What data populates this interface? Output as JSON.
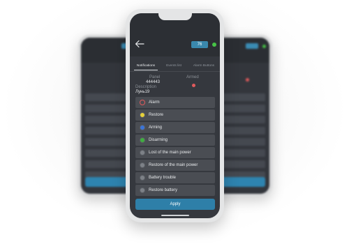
{
  "header": {
    "panel_number": "76"
  },
  "tabs": [
    {
      "label": "Notifications",
      "active": true
    },
    {
      "label": "Events list",
      "active": false
    },
    {
      "label": "Alarm Buttons",
      "active": false
    }
  ],
  "panel_info": {
    "panel_label": "Panel",
    "panel_value": "444443",
    "armed_label": "Armed",
    "description_label": "Description",
    "description_value": "Лунь19"
  },
  "notifications": [
    {
      "label": "Alarm",
      "icon": "alarm-ring-icon",
      "color": "#e05a5c",
      "style": "ring"
    },
    {
      "label": "Restore",
      "icon": "restore-dot-icon",
      "color": "#e6d13a",
      "style": "filled"
    },
    {
      "label": "Arming",
      "icon": "arming-dot-icon",
      "color": "#3b74d8",
      "style": "filled"
    },
    {
      "label": "Disarming",
      "icon": "disarming-dot-icon",
      "color": "#3fae3f",
      "style": "filled"
    },
    {
      "label": "Lost of the main power",
      "icon": "grey-dot-icon",
      "color": "#7d8187",
      "style": "filled"
    },
    {
      "label": "Restore of the main power",
      "icon": "grey-dot-icon",
      "color": "#7d8187",
      "style": "filled"
    },
    {
      "label": "Battery trouble",
      "icon": "grey-dot-icon",
      "color": "#7d8187",
      "style": "filled"
    },
    {
      "label": "Restore battery",
      "icon": "grey-dot-icon",
      "color": "#7d8187",
      "style": "filled"
    }
  ],
  "apply_label": "Apply",
  "colors": {
    "accent": "#2e7fa8",
    "status_online": "#47c447",
    "armed": "#e05a5c"
  }
}
